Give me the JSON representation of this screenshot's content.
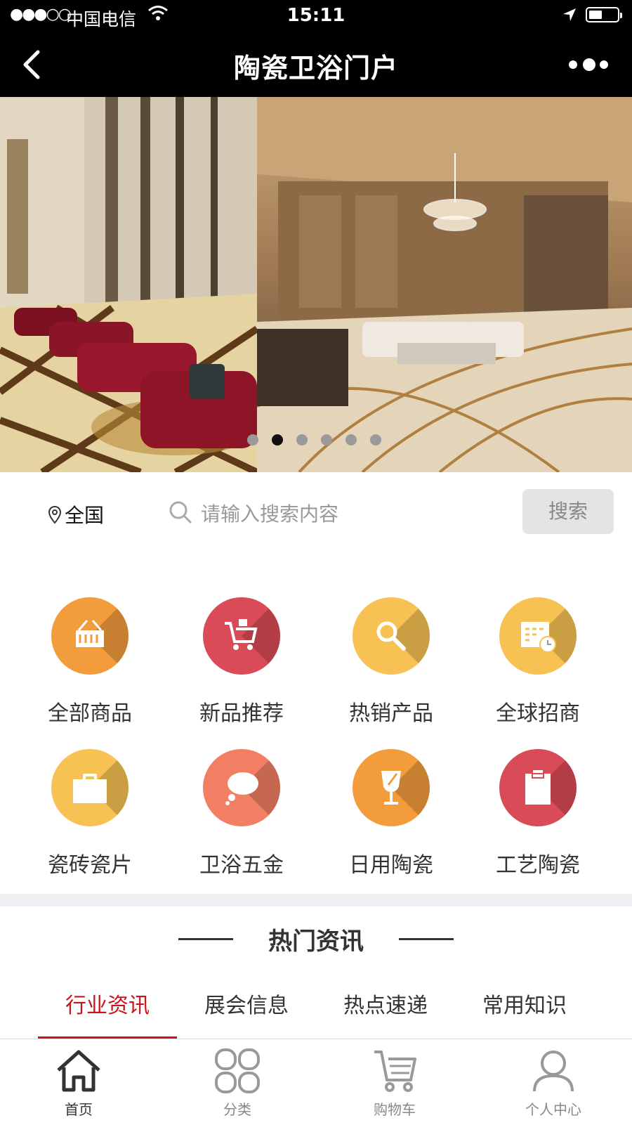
{
  "status_bar": {
    "signal": "●●●○○",
    "carrier": "中国电信",
    "time": "15:11"
  },
  "nav": {
    "title": "陶瓷卫浴门户"
  },
  "banner": {
    "slide_count": 6,
    "active_index": 1
  },
  "search": {
    "region": "全国",
    "placeholder": "请输入搜索内容",
    "button": "搜索"
  },
  "categories": [
    {
      "label": "全部商品",
      "icon": "basket-icon",
      "color": "#f39c3c"
    },
    {
      "label": "新品推荐",
      "icon": "cart-icon",
      "color": "#d94b56"
    },
    {
      "label": "热销产品",
      "icon": "magnifier-icon",
      "color": "#f7c253"
    },
    {
      "label": "全球招商",
      "icon": "calendar-clock-icon",
      "color": "#f7c253"
    },
    {
      "label": "瓷砖瓷片",
      "icon": "briefcase-icon",
      "color": "#f7c253"
    },
    {
      "label": "卫浴五金",
      "icon": "speech-bubble-icon",
      "color": "#f27f63"
    },
    {
      "label": "日用陶瓷",
      "icon": "glass-icon",
      "color": "#f39c3c"
    },
    {
      "label": "工艺陶瓷",
      "icon": "clipboard-icon",
      "color": "#d94b56"
    }
  ],
  "news": {
    "title": "热门资讯",
    "tabs": [
      "行业资讯",
      "展会信息",
      "热点速递",
      "常用知识"
    ],
    "active_tab": 0,
    "accent_color": "#c8141e"
  },
  "tabbar": [
    {
      "label": "首页",
      "icon": "home-icon",
      "active": true
    },
    {
      "label": "分类",
      "icon": "category-grid-icon",
      "active": false
    },
    {
      "label": "购物车",
      "icon": "shopping-cart-icon",
      "active": false
    },
    {
      "label": "个人中心",
      "icon": "user-icon",
      "active": false
    }
  ]
}
